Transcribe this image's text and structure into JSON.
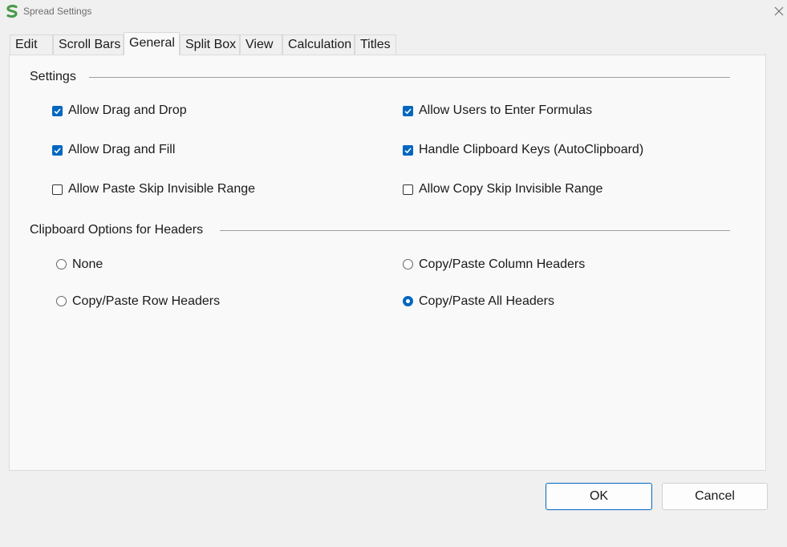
{
  "window": {
    "title": "Spread Settings",
    "accent": "#0067c0"
  },
  "tabs": [
    {
      "label": "Edit"
    },
    {
      "label": "Scroll Bars"
    },
    {
      "label": "General",
      "active": true
    },
    {
      "label": "Split Box"
    },
    {
      "label": "View"
    },
    {
      "label": "Calculation"
    },
    {
      "label": "Titles"
    }
  ],
  "settings": {
    "label": "Settings",
    "options": [
      {
        "label": "Allow Drag and Drop",
        "checked": true
      },
      {
        "label": "Allow Users to Enter Formulas",
        "checked": true
      },
      {
        "label": "Allow Drag and Fill",
        "checked": true
      },
      {
        "label": "Handle Clipboard Keys (AutoClipboard)",
        "checked": true
      },
      {
        "label": "Allow Paste Skip Invisible Range",
        "checked": false
      },
      {
        "label": "Allow Copy Skip Invisible Range",
        "checked": false
      }
    ]
  },
  "clipboard": {
    "label": "Clipboard Options for Headers",
    "options": [
      {
        "label": "None",
        "selected": false
      },
      {
        "label": "Copy/Paste Column Headers",
        "selected": false
      },
      {
        "label": "Copy/Paste Row Headers",
        "selected": false
      },
      {
        "label": "Copy/Paste All Headers",
        "selected": true
      }
    ]
  },
  "buttons": {
    "ok": "OK",
    "cancel": "Cancel"
  }
}
